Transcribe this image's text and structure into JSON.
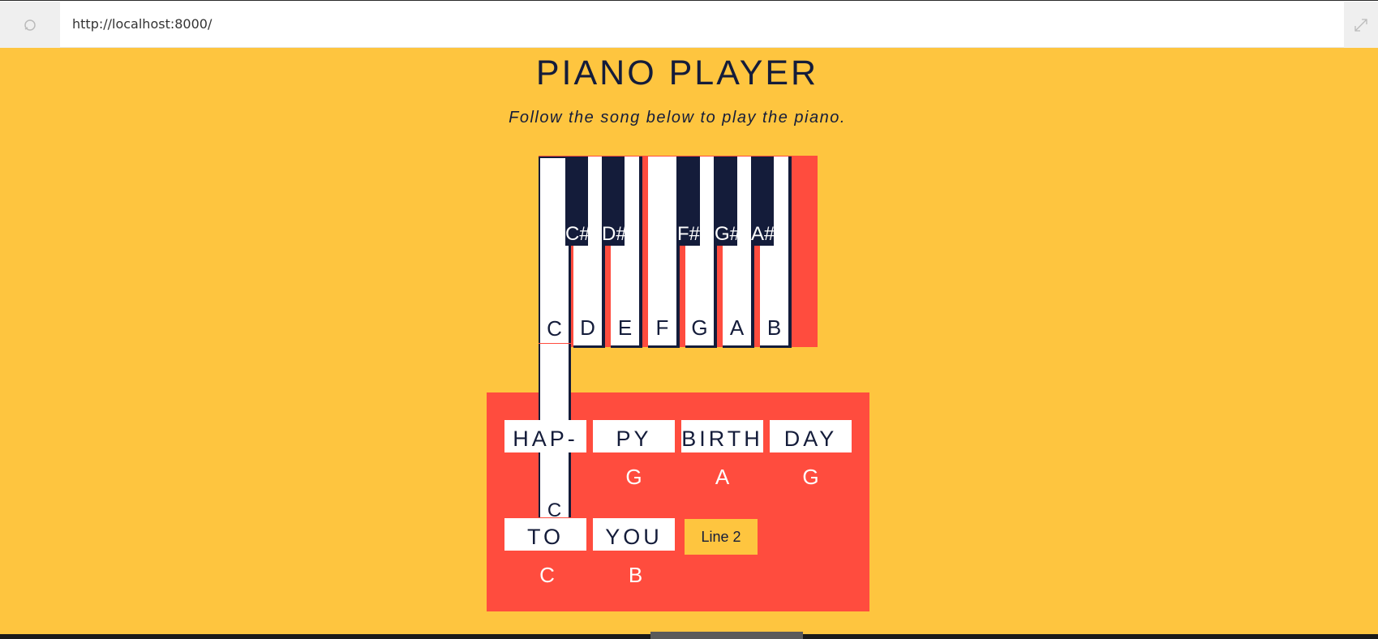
{
  "browser": {
    "url": "http://localhost:8000/",
    "reload_icon": "reload-icon",
    "expand_icon": "expand-icon"
  },
  "page": {
    "title": "PIANO PLAYER",
    "subtitle": "Follow the song below to play the piano."
  },
  "piano": {
    "white_keys": [
      "C",
      "D",
      "E",
      "F",
      "G",
      "A",
      "B"
    ],
    "black_keys": [
      "C#",
      "D#",
      "F#",
      "G#",
      "A#"
    ],
    "pressed_key_label": "C"
  },
  "song": {
    "line1": [
      {
        "word": "HAP-",
        "note": "C"
      },
      {
        "word": "PY",
        "note": "G"
      },
      {
        "word": "BIRTH",
        "note": "A"
      },
      {
        "word": "DAY",
        "note": "G"
      }
    ],
    "line2": [
      {
        "word": "TO",
        "note": "C"
      },
      {
        "word": "YOU",
        "note": "B"
      }
    ],
    "next_button_label": "Line 2"
  },
  "colors": {
    "background": "#FEC53F",
    "accent": "#FF4C3E",
    "dark": "#141C3A"
  }
}
